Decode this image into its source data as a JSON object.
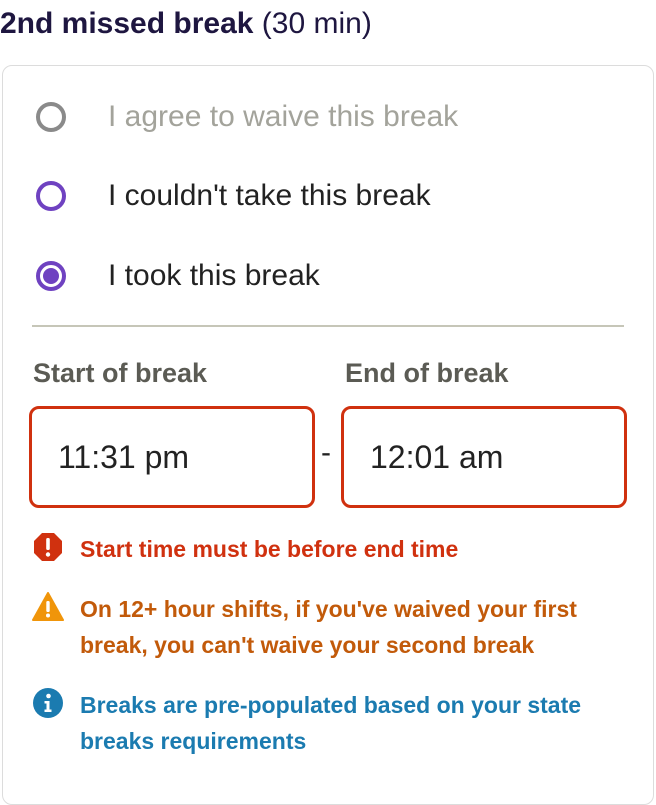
{
  "section": {
    "title": "2nd missed break",
    "duration": "(30 min)"
  },
  "options": [
    {
      "label": "I agree to waive this break",
      "state": "disabled"
    },
    {
      "label": "I couldn't take this break",
      "state": "unselected"
    },
    {
      "label": "I took this break",
      "state": "selected"
    }
  ],
  "fields": {
    "start_label": "Start of break",
    "end_label": "End of break",
    "start_value": "11:31 pm",
    "end_value": "12:01 am",
    "separator": "-"
  },
  "messages": {
    "error": "Start time must be before end time",
    "warning": "On 12+ hour shifts, if you've waived your first break, you can't waive your second break",
    "info": "Breaks are pre-populated based on your state breaks requirements"
  },
  "icons": {
    "error": "alert-octagon-icon",
    "warning": "warning-triangle-icon",
    "info": "info-circle-icon"
  },
  "colors": {
    "accent": "#6f42c1",
    "error": "#d0310f",
    "warning": "#c25a0a",
    "info": "#1b7bb0"
  }
}
